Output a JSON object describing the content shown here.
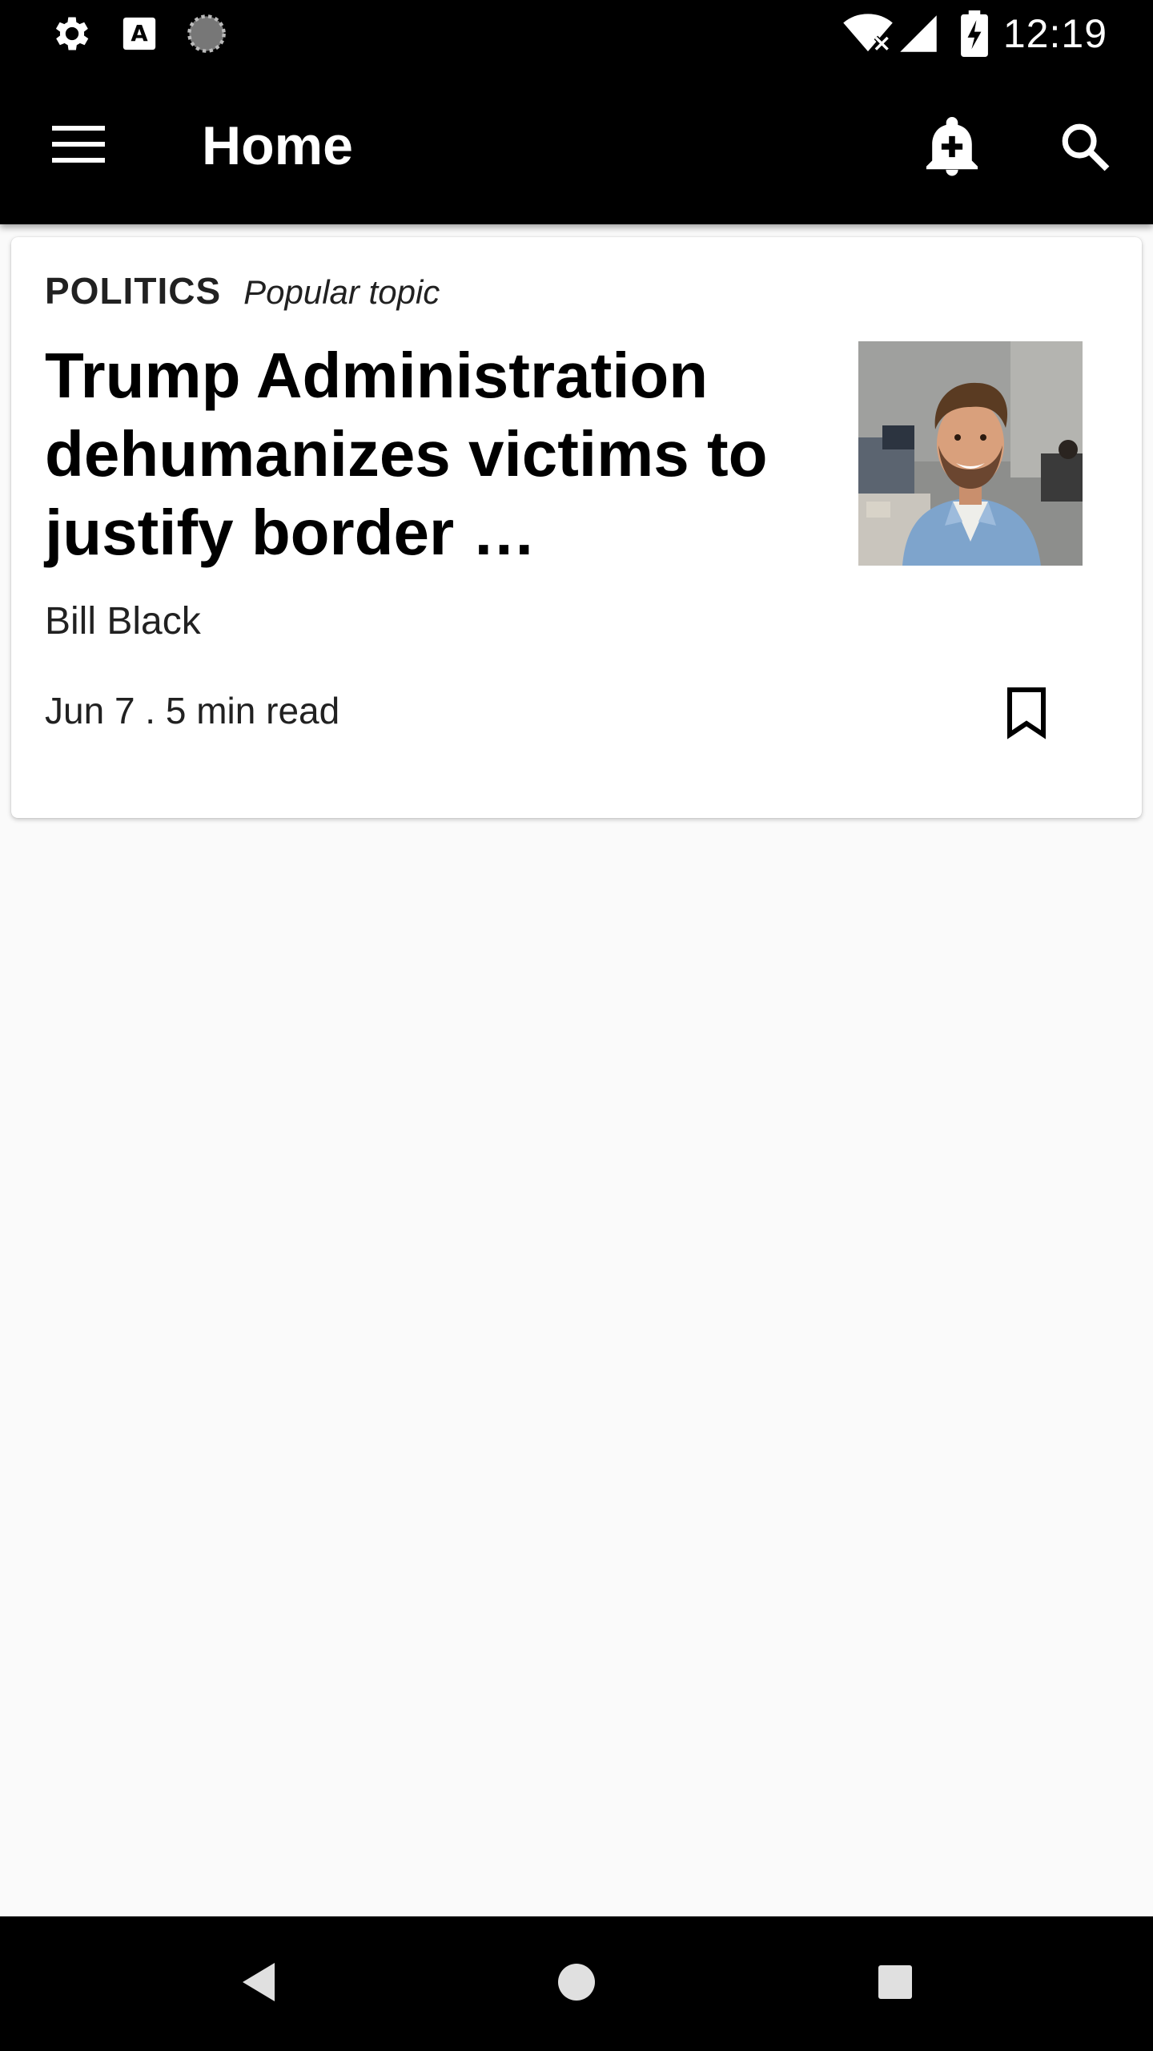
{
  "status_bar": {
    "time": "12:19",
    "left_icons": [
      "settings-icon",
      "font-a-icon",
      "loading-circle-icon"
    ],
    "right_icons": [
      "wifi-off-icon",
      "signal-icon",
      "battery-charging-icon"
    ]
  },
  "app_bar": {
    "title": "Home",
    "icons": [
      "menu-icon",
      "add-alert-icon",
      "search-icon"
    ]
  },
  "feed": {
    "items": [
      {
        "topic": "POLITICS",
        "topic_note": "Popular topic",
        "headline": "Trump Administration dehumanizes victims to justify border …",
        "author": "Bill Black",
        "meta": "Jun 7 . 5 min read",
        "thumbnail": "author-photo",
        "bookmark_icon": "bookmark-icon"
      }
    ]
  },
  "nav_bar": {
    "icons": [
      "back-icon",
      "home-icon",
      "recents-icon"
    ]
  },
  "colors": {
    "bars": "#000000",
    "background": "#fafafa",
    "card": "#ffffff",
    "text_primary": "#000000",
    "text_secondary": "#212121"
  }
}
